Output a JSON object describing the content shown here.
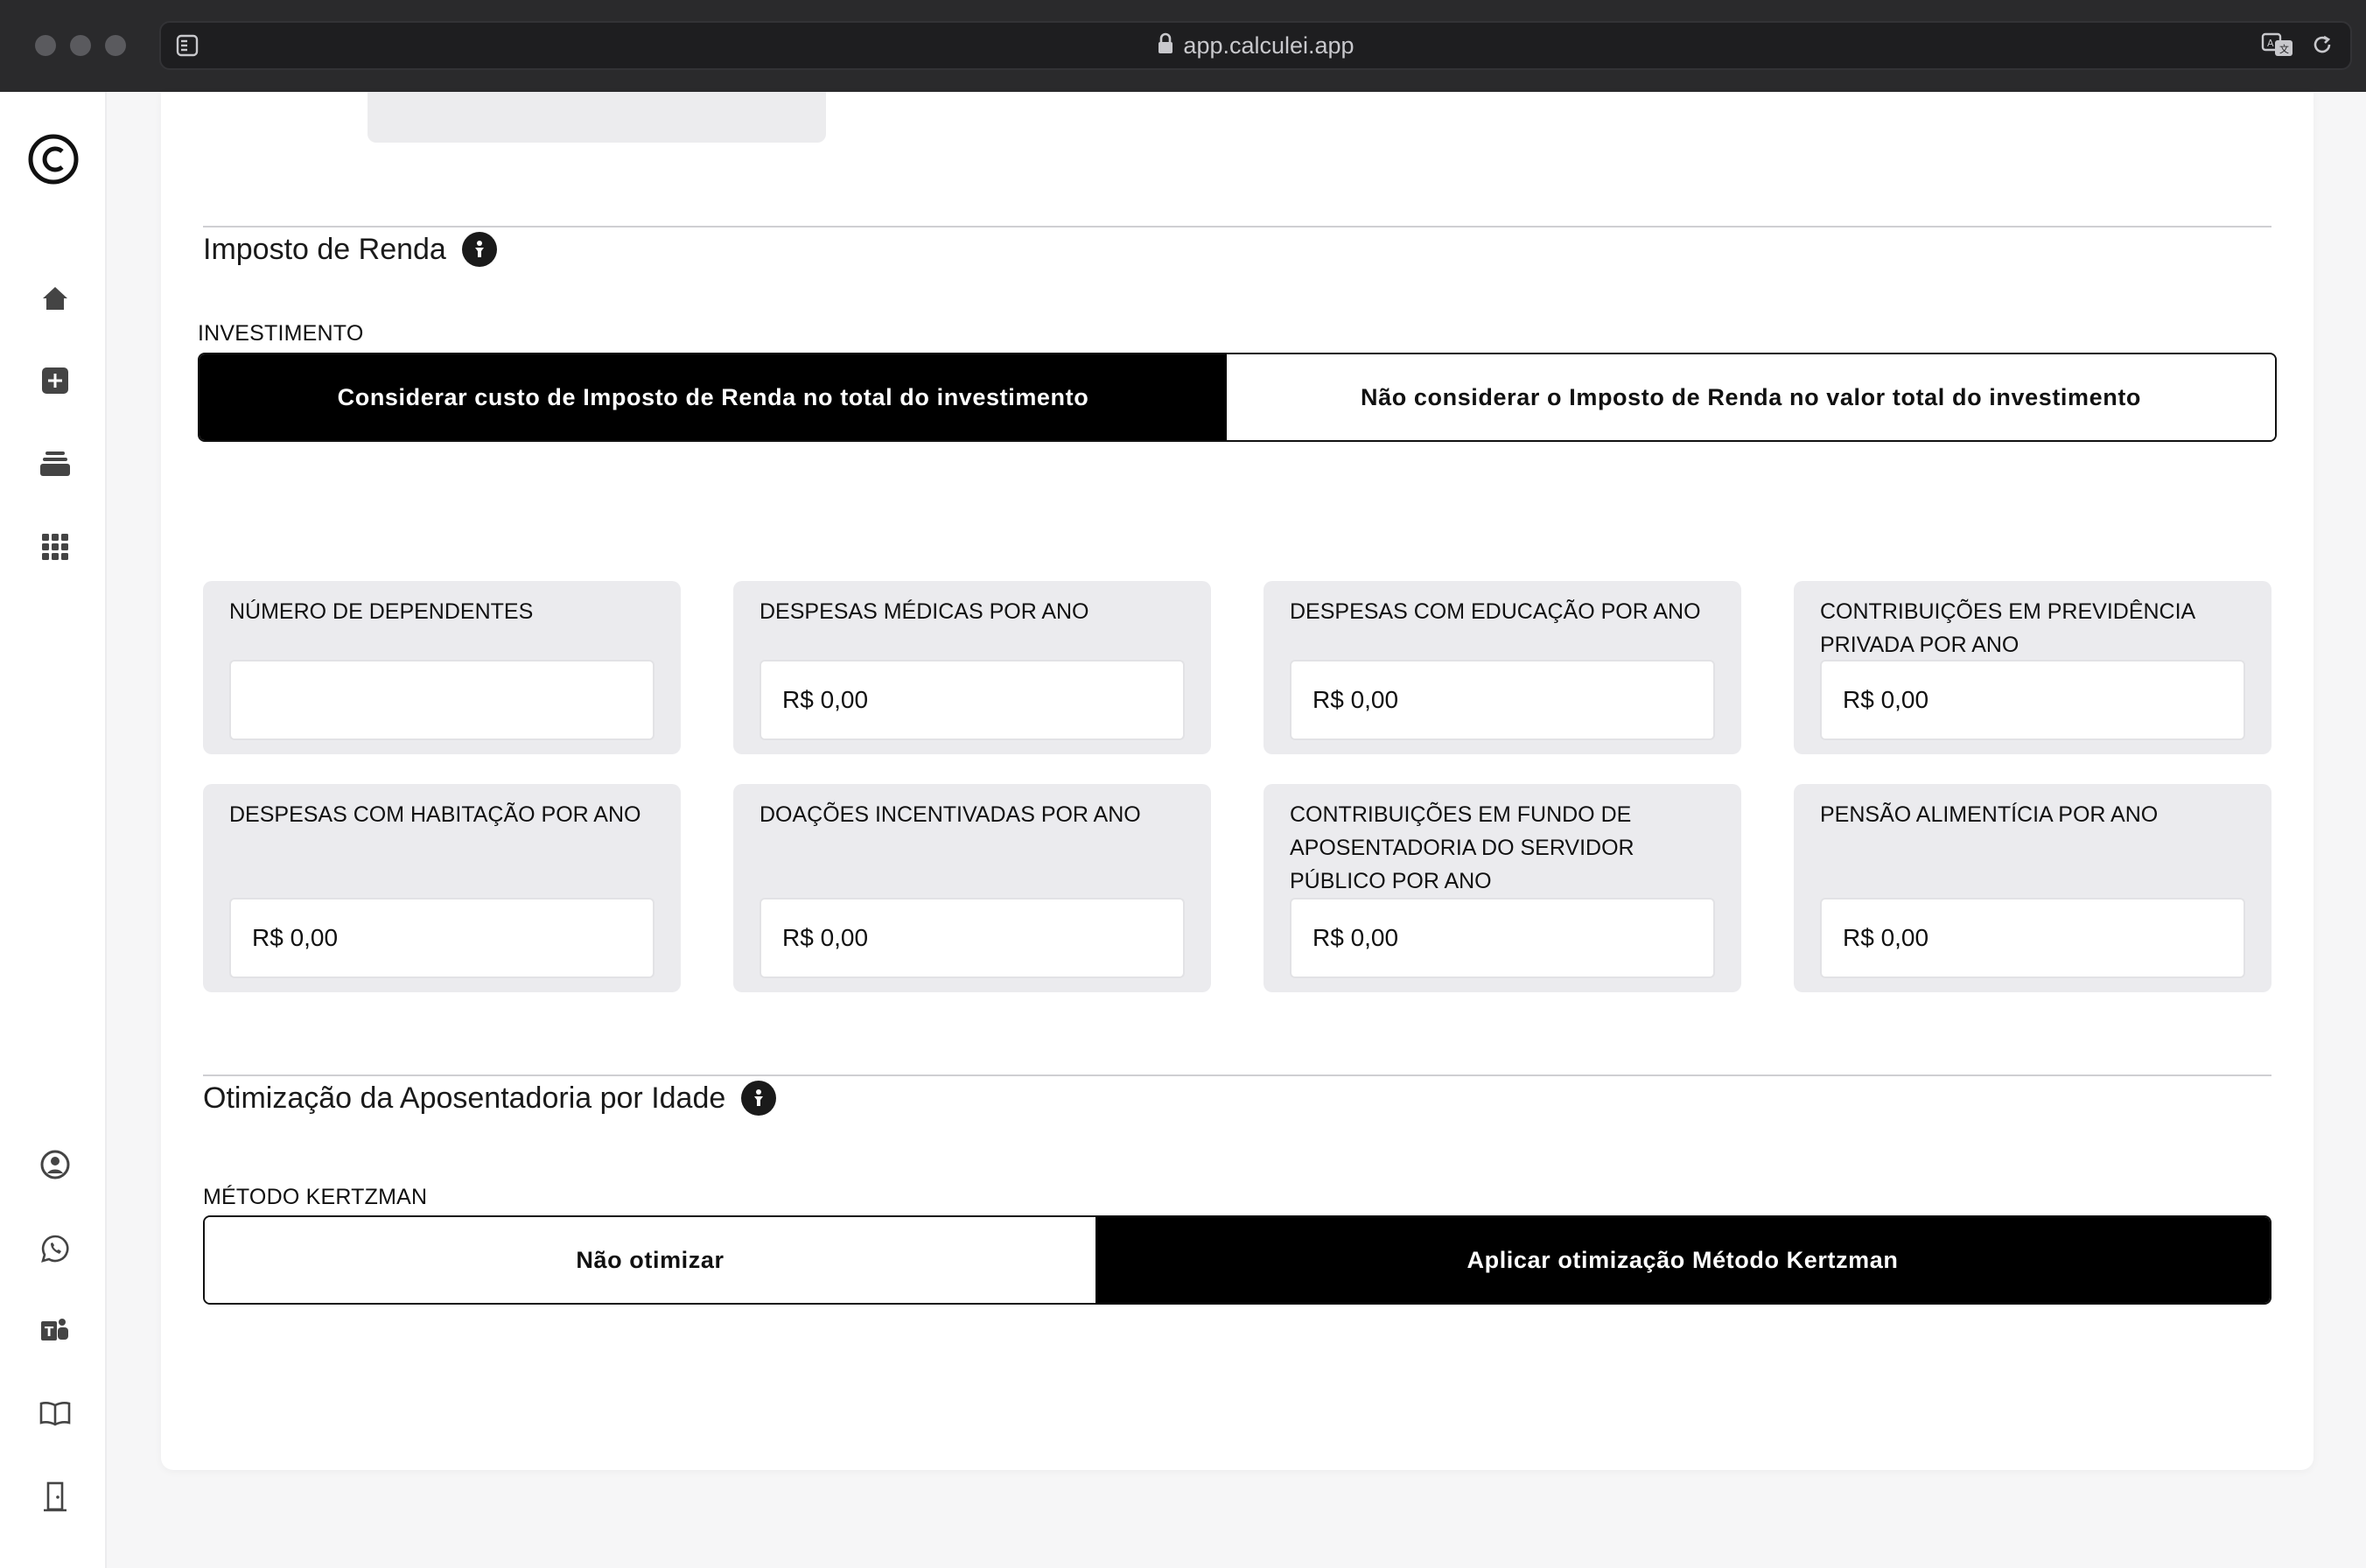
{
  "browser": {
    "url": "app.calculei.app"
  },
  "sidebar": {
    "logo_icon": "calculei-logo-icon",
    "top_items": [
      {
        "icon": "home-icon"
      },
      {
        "icon": "plus-square-icon"
      },
      {
        "icon": "layers-icon"
      },
      {
        "icon": "grid-icon"
      }
    ],
    "bottom_items": [
      {
        "icon": "user-circle-icon"
      },
      {
        "icon": "whatsapp-icon"
      },
      {
        "icon": "teams-icon"
      },
      {
        "icon": "book-icon"
      },
      {
        "icon": "door-exit-icon"
      }
    ]
  },
  "imposto": {
    "title": "Imposto de Renda",
    "investimento_label": "INVESTIMENTO",
    "option_active": "Considerar custo de Imposto de Renda no total do investimento",
    "option_inactive": "Não considerar o Imposto de Renda no valor total do investimento",
    "fields": [
      {
        "label": "NÚMERO DE DEPENDENTES",
        "value": ""
      },
      {
        "label": "DESPESAS MÉDICAS POR ANO",
        "value": "R$ 0,00"
      },
      {
        "label": "DESPESAS COM EDUCAÇÃO POR ANO",
        "value": "R$ 0,00"
      },
      {
        "label": "CONTRIBUIÇÕES EM PREVIDÊNCIA PRIVADA POR ANO",
        "value": "R$ 0,00"
      },
      {
        "label": "DESPESAS COM HABITAÇÃO POR ANO",
        "value": "R$ 0,00"
      },
      {
        "label": "DOAÇÕES INCENTIVADAS POR ANO",
        "value": "R$ 0,00"
      },
      {
        "label": "CONTRIBUIÇÕES EM FUNDO DE APOSENTADORIA DO SERVIDOR PÚBLICO POR ANO",
        "value": "R$ 0,00"
      },
      {
        "label": "PENSÃO ALIMENTÍCIA POR ANO",
        "value": "R$ 0,00"
      }
    ]
  },
  "otimizacao": {
    "title": "Otimização da Aposentadoria por Idade",
    "metodo_label": "MÉTODO KERTZMAN",
    "option_inactive": "Não otimizar",
    "option_active": "Aplicar otimização Método Kertzman"
  }
}
